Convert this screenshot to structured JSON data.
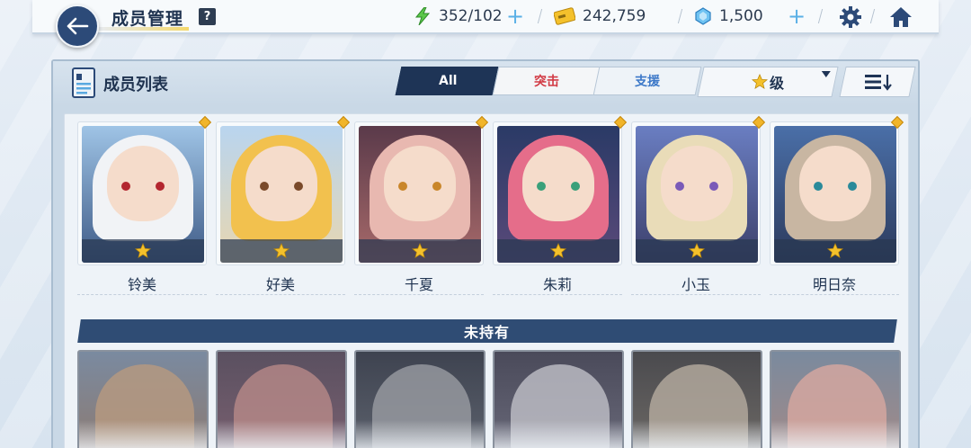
{
  "header": {
    "title": "成员管理",
    "help": "?",
    "energy": "352/102",
    "credits": "242,759",
    "gems": "1,500",
    "icons": [
      "back-arrow-icon",
      "lightning-icon",
      "credit-card-icon",
      "crystal-icon",
      "gear-icon",
      "home-icon"
    ]
  },
  "panel": {
    "title": "成员列表",
    "tabs": [
      {
        "label": "All",
        "active": true
      },
      {
        "label": "突击",
        "active": false
      },
      {
        "label": "支援",
        "active": false
      }
    ],
    "sort_label": "级",
    "order_icon": "sort-descending-icon"
  },
  "owned": [
    {
      "name": "铃美",
      "stars": 1
    },
    {
      "name": "好美",
      "stars": 1
    },
    {
      "name": "千夏",
      "stars": 1
    },
    {
      "name": "朱莉",
      "stars": 1
    },
    {
      "name": "小玉",
      "stars": 1
    },
    {
      "name": "明日奈",
      "stars": 1
    }
  ],
  "not_owned_label": "未持有",
  "colors": {
    "accent_dark": "#1e3456",
    "strike_red": "#d23a44",
    "support_blue": "#3c78c8",
    "star_gold": "#f4c12c"
  }
}
